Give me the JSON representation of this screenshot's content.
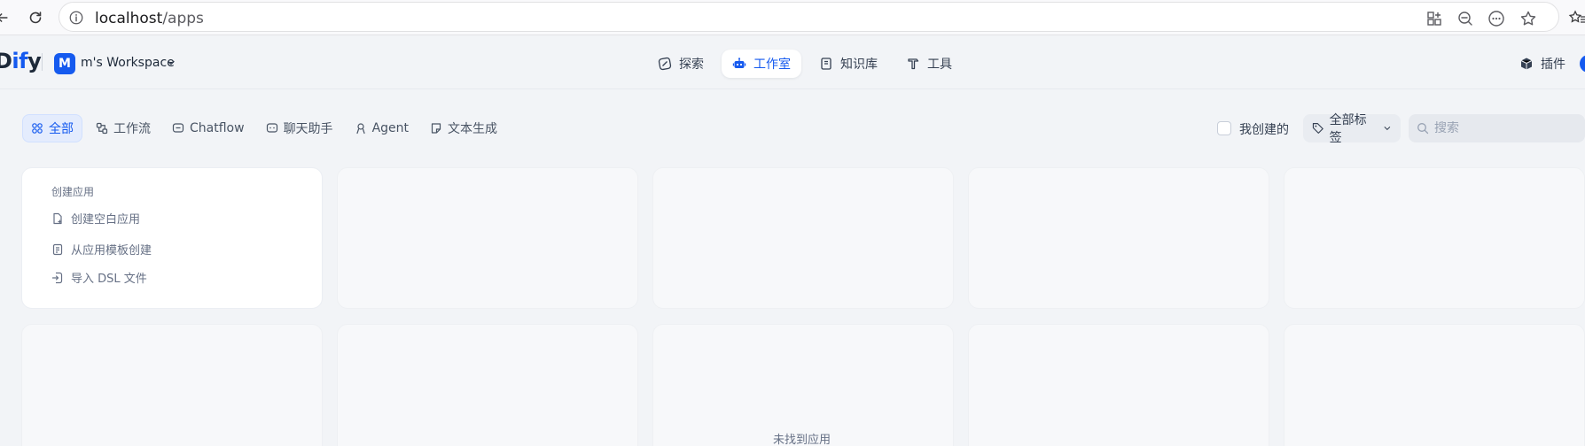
{
  "browser": {
    "url_host": "localhost",
    "url_path": "/apps"
  },
  "header": {
    "logo_left": "D",
    "logo_accent": "if",
    "logo_right": "y",
    "workspace_initial": "M",
    "workspace_name": "m's Workspace",
    "nav": [
      {
        "label": "探索",
        "icon": "compass-icon"
      },
      {
        "label": "工作室",
        "icon": "robot-icon",
        "active": true
      },
      {
        "label": "知识库",
        "icon": "book-icon"
      },
      {
        "label": "工具",
        "icon": "hammer-icon"
      }
    ],
    "plugins_label": "插件"
  },
  "filters": {
    "tabs": [
      {
        "label": "全部",
        "icon": "grid-icon",
        "active": true
      },
      {
        "label": "工作流",
        "icon": "workflow-icon"
      },
      {
        "label": "Chatflow",
        "icon": "chat-bubble-icon"
      },
      {
        "label": "聊天助手",
        "icon": "chat-assistant-icon"
      },
      {
        "label": "Agent",
        "icon": "agent-icon"
      },
      {
        "label": "文本生成",
        "icon": "document-icon"
      }
    ],
    "created_by_me_label": "我创建的",
    "all_tags_label": "全部标签",
    "search_placeholder": "搜索"
  },
  "create_app": {
    "title": "创建应用",
    "items": [
      {
        "label": "创建空白应用",
        "icon": "file-plus-icon"
      },
      {
        "label": "从应用模板创建",
        "icon": "template-icon"
      },
      {
        "label": "导入 DSL 文件",
        "icon": "import-icon"
      }
    ]
  },
  "empty_state": "未找到应用",
  "colors": {
    "accent": "#155aef",
    "background": "#f2f4f7",
    "placeholder_card": "#f7f8fa"
  }
}
